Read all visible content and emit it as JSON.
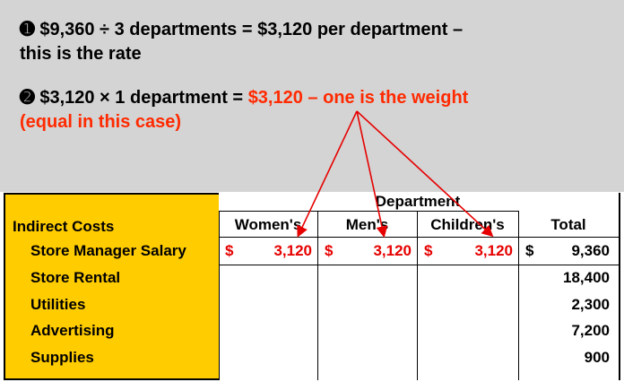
{
  "callout": {
    "line1_marker": "➊",
    "line1_text": "$9,360 ÷ 3 departments = $3,120 per department –",
    "line2_text": "this is the rate",
    "line3_marker": "➋",
    "line3_text": "$3,120 × 1 department =",
    "line3_highlight": "$3,120 – one is the weight",
    "line4_highlight": "(equal in this case)"
  },
  "table": {
    "group_header": "Department",
    "row_group_label": "Indirect Costs",
    "columns": [
      "Women's",
      "Men's",
      "Children's",
      "Total"
    ],
    "currency_symbol": "$",
    "rows": [
      {
        "label": "Store Manager Salary",
        "womens": "3,120",
        "mens": "3,120",
        "childrens": "3,120",
        "total": "9,360"
      },
      {
        "label": "Store Rental",
        "total": "18,400"
      },
      {
        "label": "Utilities",
        "total": "2,300"
      },
      {
        "label": "Advertising",
        "total": "7,200"
      },
      {
        "label": "Supplies",
        "total": "900"
      }
    ]
  },
  "colors": {
    "highlight": "#ff2a00",
    "sheet_background": "#ffcc00",
    "callout_background": "#d4d4d4",
    "arrow": "#e60000"
  }
}
